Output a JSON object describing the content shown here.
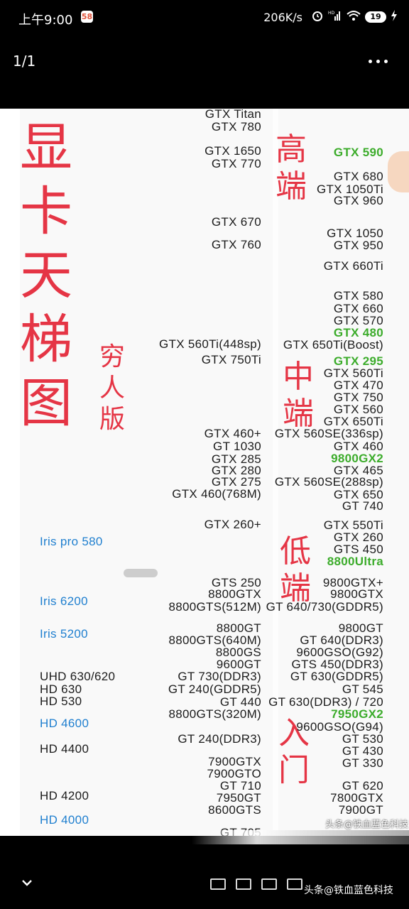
{
  "status_bar": {
    "time": "上午9:00",
    "app_badge": "58",
    "network_speed": "206K/s",
    "hd_label": "HD",
    "battery": "19"
  },
  "viewer": {
    "page_counter": "1/1"
  },
  "image": {
    "title": "显卡天梯图",
    "subtitle": "穷人版",
    "tiers": {
      "high": "高端",
      "mid": "中端",
      "low": "低端",
      "entry": "入门"
    },
    "middle_column": [
      "GTX Titan",
      "GTX 780",
      "GTX 1650",
      "GTX 770",
      "GTX 670",
      "GTX 760",
      "GTX 560Ti(448sp)",
      "GTX 750Ti",
      "GTX 460+",
      "GT 1030",
      "GTX 285",
      "GTX 280",
      "GTX 275",
      "GTX 460(768M)",
      "GTX 260+",
      "GTS 250",
      "8800GTX",
      "8800GTS(512M)",
      "8800GT",
      "8800GTS(640M)",
      "8800GS",
      "9600GT",
      "GT 730(DDR3)",
      "GT 240(GDDR5)",
      "GT 440",
      "8800GTS(320M)",
      "GT 240(DDR3)",
      "7900GTX",
      "7900GTO",
      "GT 710",
      "7950GT",
      "8600GTS",
      "GT 705"
    ],
    "right_column": [
      "GTX 590",
      "GTX 680",
      "GTX 1050Ti",
      "GTX 960",
      "GTX 1050",
      "GTX 950",
      "GTX 660Ti",
      "GTX 580",
      "GTX 660",
      "GTX 570",
      "GTX 480",
      "GTX 650Ti(Boost)",
      "GTX 295",
      "GTX 560Ti",
      "GTX 470",
      "GTX 750",
      "GTX 560",
      "GTX 650Ti",
      "GTX 560SE(336sp)",
      "GTX 460",
      "9800GX2",
      "GTX 465",
      "GTX 560SE(288sp)",
      "GTX 650",
      "GT 740",
      "GTX 550Ti",
      "GTX 260",
      "GTS 450",
      "8800Ultra",
      "9800GTX+",
      "9800GTX",
      "GT 640/730(GDDR5)",
      "9800GT",
      "GT 640(DDR3)",
      "9600GSO(G92)",
      "GTS 450(DDR3)",
      "GT 630(GDDR5)",
      "GT 545",
      "GT 630(DDR3) / 720",
      "7950GX2",
      "9600GSO(G94)",
      "GT 530",
      "GT 430",
      "GT 330",
      "GT 620",
      "7800GTX",
      "7900GT"
    ],
    "left_column": [
      "Iris pro 580",
      "Iris 6200",
      "Iris 5200",
      "UHD 630/620",
      "HD 630",
      "HD 530",
      "HD 4600",
      "HD 4400",
      "HD 4200",
      "HD 4000"
    ],
    "highlight_color": "#3cac2b",
    "title_color": "#e53545",
    "intel_color": "#1f7fcf",
    "inner_watermark": "头条@铁血蓝色科技"
  },
  "bottom": {
    "watermark": "头条@铁血蓝色科技"
  }
}
